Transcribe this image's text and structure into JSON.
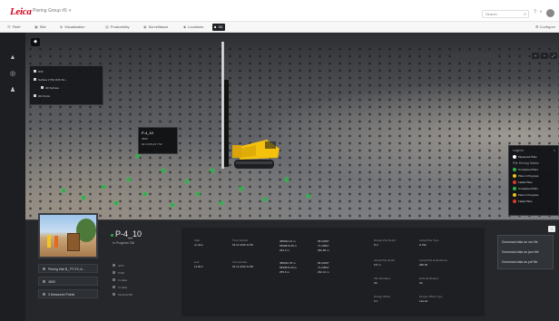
{
  "header": {
    "brand": "Leica",
    "project": "Piering Group #5",
    "search_placeholder": "Search"
  },
  "nav": {
    "tabs": [
      {
        "label": "Fleet"
      },
      {
        "label": "Site"
      },
      {
        "label": "Visualization"
      },
      {
        "label": "Productivity"
      },
      {
        "label": "Surveillance"
      },
      {
        "label": "Locations"
      },
      {
        "label": "3D"
      }
    ],
    "configure": "Configure"
  },
  "layers": {
    "items": [
      {
        "label": "DXF"
      },
      {
        "label": "Surface (TIN) DXF file ..."
      },
      {
        "label": "3D Surface"
      },
      {
        "label": "3D Points"
      }
    ]
  },
  "tooltip": {
    "title": "P-4_10",
    "line1": "4500",
    "line2": "62.10 65.43 7.52"
  },
  "legend": {
    "title": "Legend",
    "measured": "Measured Piles",
    "section": "Pile Driving Status",
    "items": [
      {
        "label": "Completed Piles",
        "color": "#2fb04a"
      },
      {
        "label": "Piles in Progress",
        "color": "#e8c21c"
      },
      {
        "label": "Failed Piles",
        "color": "#d63a2a"
      },
      {
        "label": "Completed Piles",
        "color": "#2fb04a"
      },
      {
        "label": "Piles in Progress",
        "color": "#e8c21c"
      },
      {
        "label": "Failed Piles",
        "color": "#d63a2a"
      }
    ]
  },
  "detail": {
    "pile_name": "P-4_10",
    "status": "In Progress Tail",
    "list_buttons": [
      {
        "label": "Piering Hall B_ PT-FC-A..."
      },
      {
        "label": "4500"
      },
      {
        "label": "3 Measured Points"
      }
    ],
    "meta": [
      {
        "label": "4472"
      },
      {
        "label": "5 Min"
      },
      {
        "label": "In class"
      },
      {
        "label": "In class"
      },
      {
        "label": "19-04-11:50"
      }
    ],
    "props": {
      "start_label": "Start",
      "start_value": "on time",
      "end_label": "End",
      "end_value": "11:00 h",
      "time1_label": "Time Started",
      "time1_value": "03 11 2019 11:50",
      "time2_label": "Time Ended",
      "time2_value": "03 11 2019 11:58",
      "coords1": [
        "485932.12 m",
        "5690870.45 m",
        "262.2 m"
      ],
      "coords2": [
        "485932.78 m",
        "5690871.03 m",
        "255.6 m"
      ],
      "heading1": [
        "68.32487",
        "71.23567",
        "282.68 m"
      ],
      "heading2": [
        "68.32487",
        "71.23567",
        "262.41 m"
      ],
      "design_label": "Design Pile Depth",
      "design_value": "8 m",
      "pile_type_label": "Actual Pile Type",
      "pile_type_value": "H Pile",
      "depth_label": "Actual Pile Depth",
      "depth_value": "6.5 m",
      "embed_label": "Actual Pile Embedment",
      "embed_value": "280.00",
      "deviation_label": "Pile Deviation",
      "deviation_value": "Ok",
      "refusal_label": "Refusal Reason",
      "refusal_value": "Ok",
      "offset_label": "Design Offset",
      "offset_value": "0.1",
      "type_label": "Design Offset Type",
      "type_value": "Lateral"
    },
    "menu": [
      {
        "label": "Download data as csv file"
      },
      {
        "label": "Download data as json file"
      },
      {
        "label": "Download data as pdf file"
      }
    ]
  }
}
